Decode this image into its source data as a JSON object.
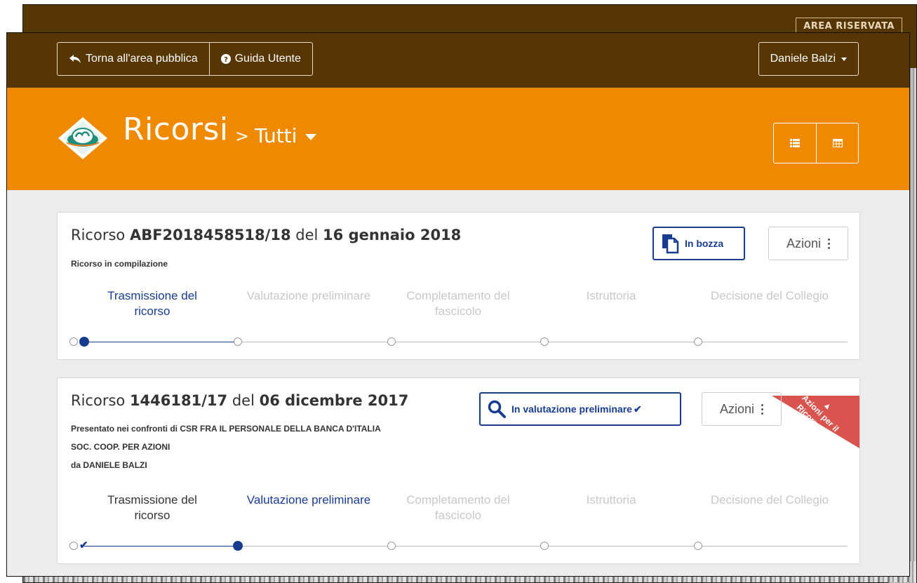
{
  "background_window": {
    "area_button_label": "AREA RISERVATA"
  },
  "topbar": {
    "back_label": "Torna all'area pubblica",
    "help_label": "Guida Utente",
    "user_label": "Daniele Balzi"
  },
  "banner": {
    "title": "Ricorsi",
    "separator": ">",
    "filter_label": "Tutti"
  },
  "steps": [
    {
      "line1": "Trasmissione del",
      "line2": "ricorso"
    },
    {
      "line1": "",
      "line2": "Valutazione preliminare"
    },
    {
      "line1": "Completamento del",
      "line2": "fascicolo"
    },
    {
      "line1": "",
      "line2": "Istruttoria"
    },
    {
      "line1": "",
      "line2": "Decisione del Collegio"
    }
  ],
  "cards": [
    {
      "title_prefix": "Ricorso",
      "number": "ABF2018458518/18",
      "date_prefix": "del",
      "date": "16 gennaio 2018",
      "subtitle": "Ricorso in compilazione",
      "status_label": "In bozza",
      "actions_label": "Azioni",
      "current_step": 0
    },
    {
      "title_prefix": "Ricorso",
      "number": "1446181/17",
      "date_prefix": "del",
      "date": "06 dicembre 2017",
      "against_prefix": "Presentato nei confronti di",
      "against": "CSR FRA IL PERSONALE DELLA BANCA D'ITALIA",
      "against_cont": "SOC. COOP. PER AZIONI",
      "by_prefix": "da",
      "by": "DANIELE BALZI",
      "status_label": "In valutazione preliminare",
      "actions_label": "Azioni",
      "ribbon_label_1": "Azioni per il",
      "ribbon_label_2": "Ricorrente",
      "current_step": 1,
      "colors": {
        "ribbon": "#d9534f"
      }
    }
  ],
  "colors": {
    "topbar": "#573605",
    "banner": "#ef8a00",
    "accent": "#173c8f"
  }
}
